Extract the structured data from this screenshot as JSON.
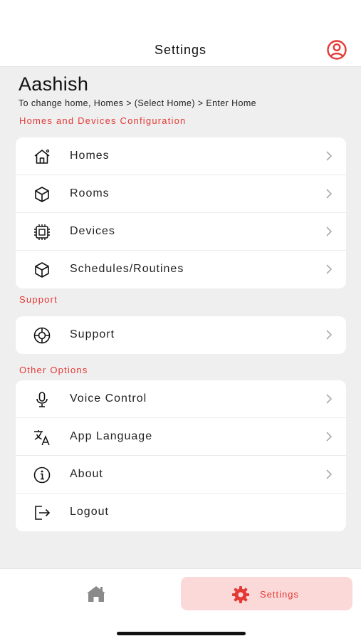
{
  "header": {
    "title": "Settings",
    "profile_icon": "user-circle-icon",
    "accent_color": "#e53935"
  },
  "user": {
    "name": "Aashish",
    "hint": "To change home, Homes > (Select Home) > Enter Home"
  },
  "sections": {
    "homes_devices": {
      "label": "Homes and Devices Configuration",
      "items": [
        {
          "label": "Homes",
          "icon": "home-icon"
        },
        {
          "label": "Rooms",
          "icon": "cube-icon"
        },
        {
          "label": "Devices",
          "icon": "chip-icon"
        },
        {
          "label": "Schedules/Routines",
          "icon": "cube-icon"
        }
      ]
    },
    "support": {
      "label": "Support",
      "items": [
        {
          "label": "Support",
          "icon": "lifebuoy-icon"
        }
      ]
    },
    "other": {
      "label": "Other Options",
      "items": [
        {
          "label": "Voice Control",
          "icon": "microphone-icon"
        },
        {
          "label": "App Language",
          "icon": "translate-icon"
        },
        {
          "label": "About",
          "icon": "info-icon"
        },
        {
          "label": "Logout",
          "icon": "logout-icon"
        }
      ]
    }
  },
  "bottom_nav": {
    "home": {
      "icon": "home-filled-icon"
    },
    "settings": {
      "label": "Settings",
      "icon": "gear-icon",
      "active": true
    }
  }
}
